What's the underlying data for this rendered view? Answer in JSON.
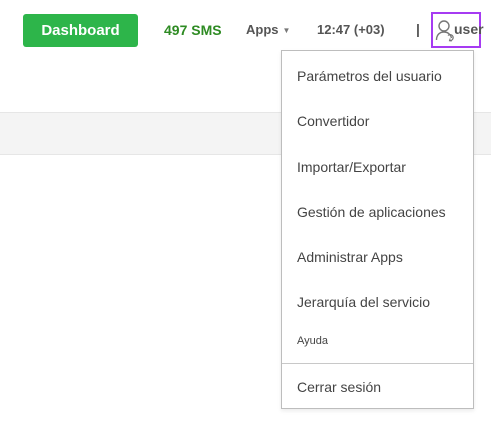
{
  "header": {
    "dashboard_label": "Dashboard",
    "sms_count": "497 SMS",
    "apps_label": "Apps",
    "time": "12:47 (+03)",
    "separator": "|",
    "user_label": "user"
  },
  "user_menu": {
    "items": [
      {
        "label": "Parámetros del usuario"
      },
      {
        "label": "Convertidor"
      },
      {
        "label": "Importar/Exportar"
      },
      {
        "label": "Gestión de aplicaciones"
      },
      {
        "label": "Administrar Apps"
      },
      {
        "label": "Jerarquía del servicio"
      },
      {
        "label": "Ayuda"
      },
      {
        "label": "Cerrar sesión"
      }
    ]
  },
  "icons": {
    "user": "user-icon",
    "apps_caret": "caret-down-icon"
  },
  "colors": {
    "dashboard_button": "#2db54a",
    "sms_text": "#2e8b23",
    "user_highlight": "#a63bf2"
  }
}
